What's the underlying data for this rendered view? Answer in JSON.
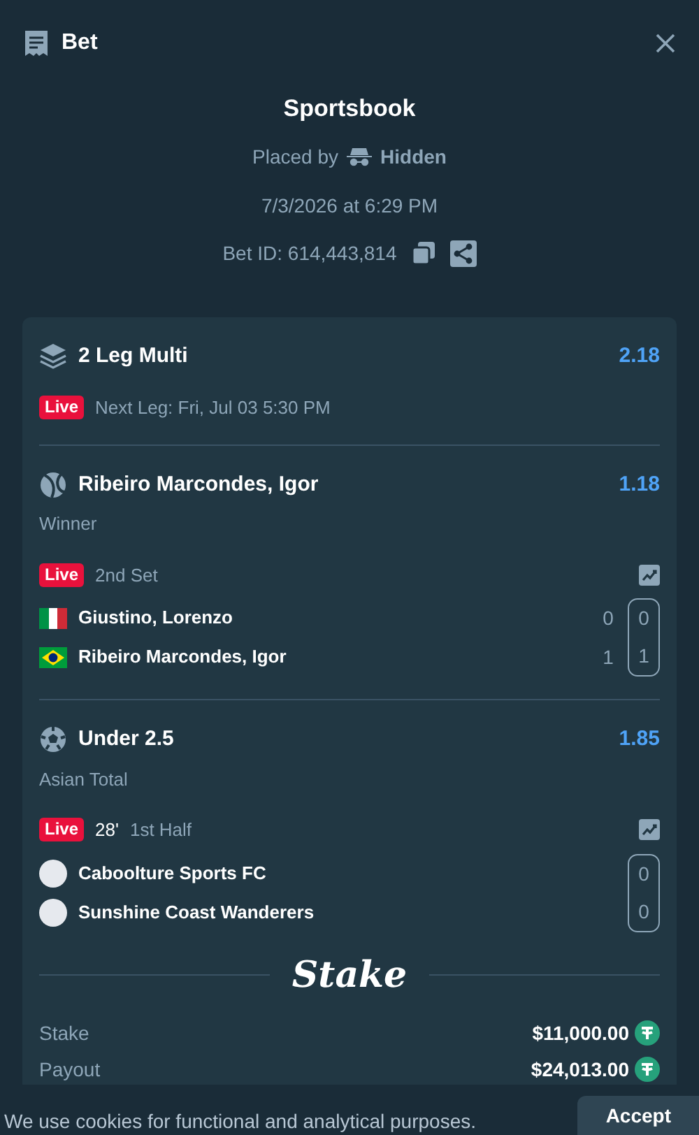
{
  "header": {
    "title": "Bet"
  },
  "summary": {
    "title": "Sportsbook",
    "placed_by_label": "Placed by",
    "user": "Hidden",
    "date": "7/3/2026 at 6:29 PM",
    "bet_id": "Bet ID: 614,443,814"
  },
  "multi": {
    "title": "2 Leg Multi",
    "odds": "2.18",
    "live_badge": "Live",
    "next_leg": "Next Leg: Fri, Jul 03 5:30 PM"
  },
  "legs": [
    {
      "kind": "tennis",
      "title": "Ribeiro Marcondes, Igor",
      "odds": "1.18",
      "market": "Winner",
      "live_badge": "Live",
      "period": "2nd Set",
      "participants": [
        {
          "name": "Giustino, Lorenzo",
          "kind": "italy",
          "scores": [
            "0"
          ],
          "boxed_score": "0"
        },
        {
          "name": "Ribeiro Marcondes, Igor",
          "kind": "brazil",
          "scores": [
            "1"
          ],
          "boxed_score": "1"
        }
      ]
    },
    {
      "kind": "soccer",
      "title": "Under 2.5",
      "odds": "1.85",
      "market": "Asian Total",
      "live_badge": "Live",
      "clock": "28'",
      "period": "1st Half",
      "participants": [
        {
          "name": "Caboolture Sports FC",
          "kind": "team",
          "boxed_score": "0"
        },
        {
          "name": "Sunshine Coast Wanderers",
          "kind": "team",
          "boxed_score": "0"
        }
      ]
    }
  ],
  "brand": "Stake",
  "totals": [
    {
      "label": "Stake",
      "amount": "$11,000.00"
    },
    {
      "label": "Payout",
      "amount": "$24,013.00"
    }
  ],
  "cookie": {
    "text": "We use cookies for functional and analytical purposes.",
    "button": "Accept"
  }
}
